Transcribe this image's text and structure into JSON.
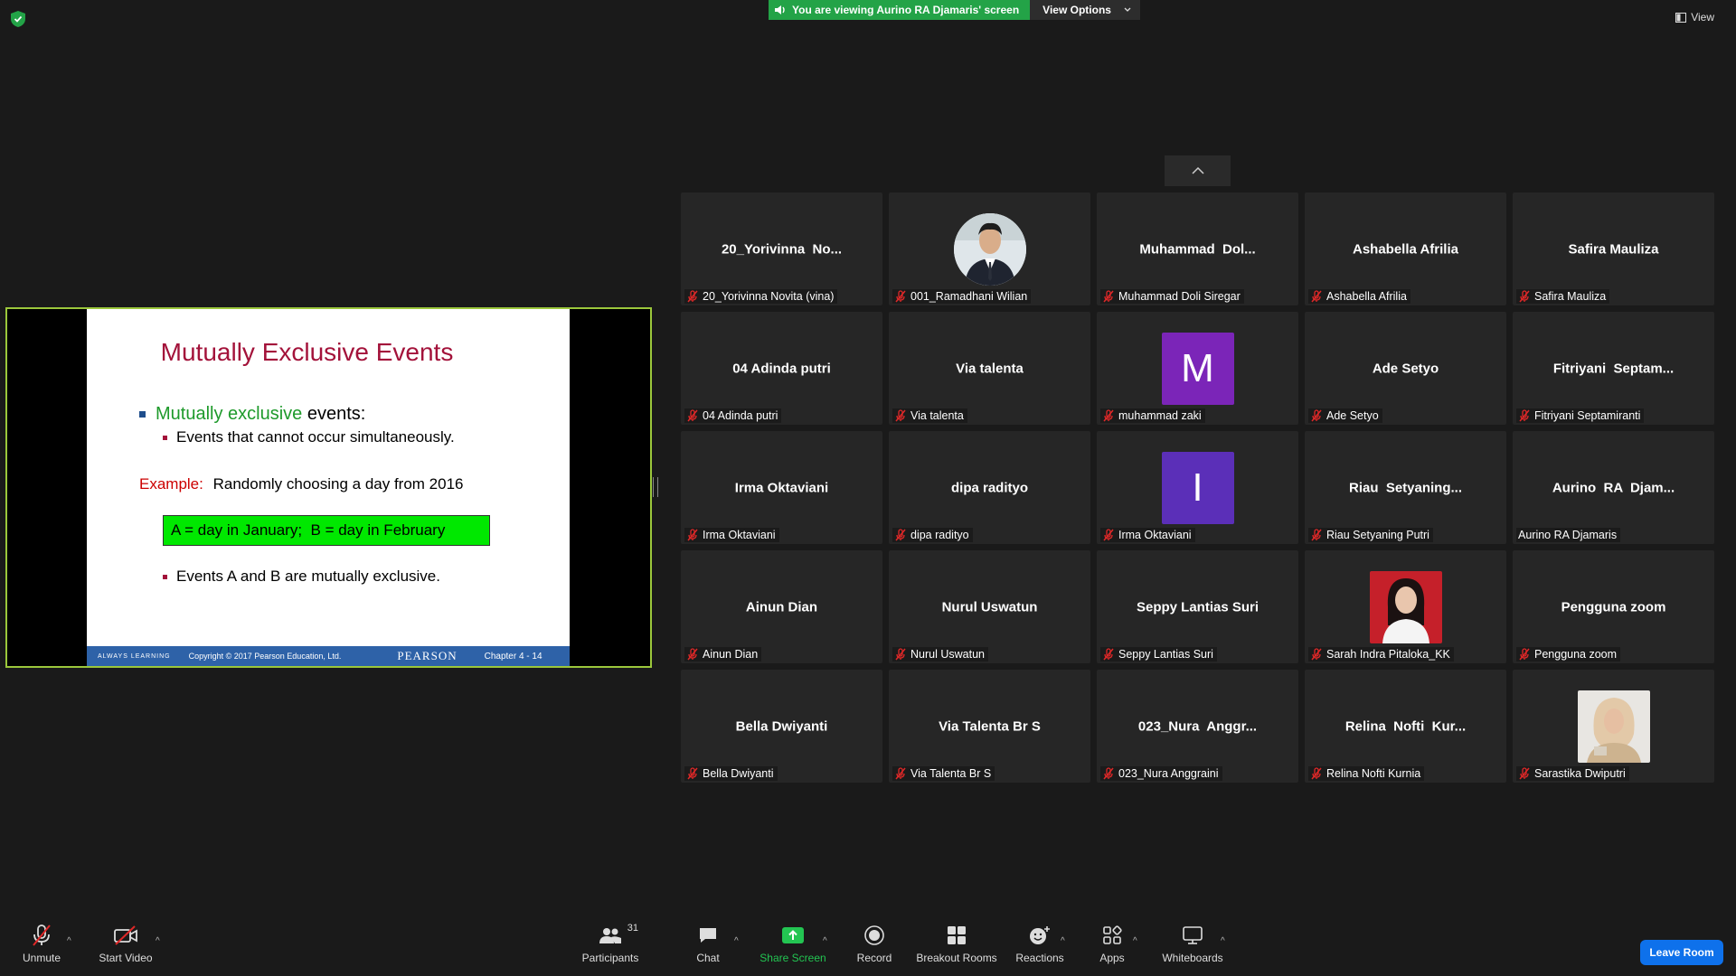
{
  "banner": {
    "viewing_text": "You are viewing Aurino RA Djamaris' screen",
    "view_options": "View Options"
  },
  "view_label": "View",
  "slide": {
    "title": "Mutually Exclusive Events",
    "bullet1_highlight": "Mutually exclusive",
    "bullet1_rest": " events:",
    "bullet2": "Events that cannot occur simultaneously.",
    "example_label": "Example:",
    "example_text": "Randomly choosing a day from 2016",
    "box_text": "A = day in January;  B = day in February",
    "bullet4": "Events A and B are mutually exclusive.",
    "footer_left": "ALWAYS LEARNING",
    "footer_copy": "Copyright © 2017 Pearson Education, Ltd.",
    "footer_brand": "PEARSON",
    "footer_chapter": "Chapter 4 - 14"
  },
  "participants": [
    {
      "center": "20_Yorivinna  No...",
      "label": "20_Yorivinna Novita (vina)",
      "muted": true,
      "avatar": null
    },
    {
      "center": "",
      "label": "001_Ramadhani Wilian",
      "muted": true,
      "avatar": "photo-man"
    },
    {
      "center": "Muhammad  Dol...",
      "label": "Muhammad Doli Siregar",
      "muted": true,
      "avatar": null
    },
    {
      "center": "Ashabella Afrilia",
      "label": "Ashabella Afrilia",
      "muted": true,
      "avatar": null
    },
    {
      "center": "Safira Mauliza",
      "label": "Safira Mauliza",
      "muted": true,
      "avatar": null
    },
    {
      "center": "04 Adinda putri",
      "label": "04 Adinda putri",
      "muted": true,
      "avatar": null
    },
    {
      "center": "Via talenta",
      "label": "Via talenta",
      "muted": true,
      "avatar": null
    },
    {
      "center": "",
      "label": "muhammad zaki",
      "muted": true,
      "avatar": "letter",
      "letter": "M",
      "color": "#7b25b8"
    },
    {
      "center": "Ade Setyo",
      "label": "Ade Setyo",
      "muted": true,
      "avatar": null
    },
    {
      "center": "Fitriyani  Septam...",
      "label": "Fitriyani Septamiranti",
      "muted": true,
      "avatar": null
    },
    {
      "center": "Irma Oktaviani",
      "label": "Irma Oktaviani",
      "muted": true,
      "avatar": null
    },
    {
      "center": "dipa radityo",
      "label": "dipa radityo",
      "muted": true,
      "avatar": null
    },
    {
      "center": "",
      "label": "Irma Oktaviani",
      "muted": true,
      "avatar": "letter",
      "letter": "I",
      "color": "#5b2fb8"
    },
    {
      "center": "Riau  Setyaning...",
      "label": "Riau Setyaning Putri",
      "muted": true,
      "avatar": null
    },
    {
      "center": "Aurino  RA  Djam...",
      "label": "Aurino RA Djamaris",
      "muted": false,
      "avatar": null
    },
    {
      "center": "Ainun Dian",
      "label": "Ainun Dian",
      "muted": true,
      "avatar": null
    },
    {
      "center": "Nurul Uswatun",
      "label": "Nurul Uswatun",
      "muted": true,
      "avatar": null
    },
    {
      "center": "Seppy Lantias Suri",
      "label": "Seppy Lantias Suri",
      "muted": true,
      "avatar": null
    },
    {
      "center": "",
      "label": "Sarah Indra Pitaloka_KK",
      "muted": true,
      "avatar": "photo-woman-red"
    },
    {
      "center": "Pengguna zoom",
      "label": "Pengguna zoom",
      "muted": true,
      "avatar": null
    },
    {
      "center": "Bella Dwiyanti",
      "label": "Bella Dwiyanti",
      "muted": true,
      "avatar": null
    },
    {
      "center": "Via Talenta Br S",
      "label": "Via Talenta Br S",
      "muted": true,
      "avatar": null
    },
    {
      "center": "023_Nura  Anggr...",
      "label": "023_Nura Anggraini",
      "muted": true,
      "avatar": null
    },
    {
      "center": "Relina  Nofti  Kur...",
      "label": "Relina Nofti Kurnia",
      "muted": true,
      "avatar": null
    },
    {
      "center": "",
      "label": "Sarastika Dwiputri",
      "muted": true,
      "avatar": "photo-woman-hijab"
    }
  ],
  "toolbar": {
    "unmute": "Unmute",
    "start_video": "Start Video",
    "participants": "Participants",
    "participants_count": "31",
    "chat": "Chat",
    "share_screen": "Share Screen",
    "record": "Record",
    "breakout_rooms": "Breakout Rooms",
    "reactions": "Reactions",
    "apps": "Apps",
    "whiteboards": "Whiteboards",
    "leave": "Leave Room"
  },
  "colors": {
    "accent_green": "#23a347",
    "leave_blue": "#0e71eb",
    "slide_border": "#9bc73b"
  }
}
